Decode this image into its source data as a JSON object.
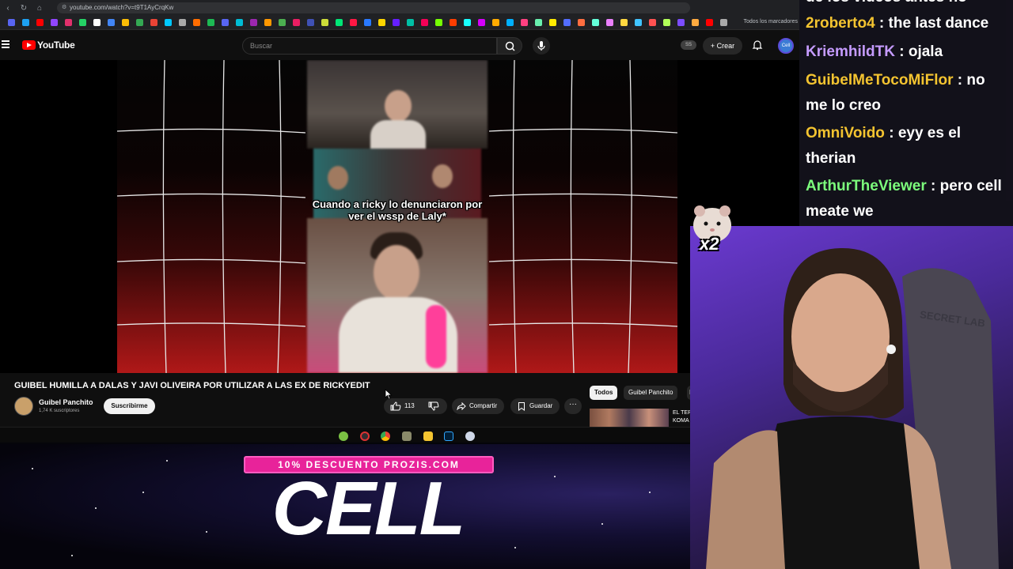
{
  "browser": {
    "url": "youtube.com/watch?v=t9T1AyCrqKw",
    "bookmarks_all_label": "Todos los marcadores"
  },
  "youtube": {
    "logo_text": "YouTube",
    "search_placeholder": "Buscar",
    "ss_badge": "SS",
    "create_label": "Crear",
    "avatar_label": "Cell"
  },
  "video": {
    "caption": "Cuando a ricky lo denunciaron por ver el wssp de Laly*",
    "title": "GUIBEL HUMILLA A DALAS Y JAVI OLIVEIRA POR UTILIZAR A LAS EX DE RICKYEDIT",
    "channel_name": "Guibel Panchito",
    "channel_subs": "1,74 K suscriptores",
    "subscribe_label": "Suscribirme",
    "like_count": "113",
    "share_label": "Compartir",
    "save_label": "Guardar",
    "more_label": "···"
  },
  "recommendations": {
    "chips": [
      "Todos",
      "Guibel Panchito",
      "I"
    ],
    "first_title": "EL TER KOMA"
  },
  "chat": {
    "top_fragment": "de los videos antes no",
    "messages": [
      {
        "user": "2roberto4",
        "text": "the last dance"
      },
      {
        "user": "KriemhildTK",
        "text": "ojala"
      },
      {
        "user": "GuibelMeTocoMiFlor",
        "text": "no me lo creo"
      },
      {
        "user": "OmniVoido",
        "text": "eyy es el therian"
      },
      {
        "user": "ArthurTheViewer",
        "text": "pero cell meate we"
      }
    ]
  },
  "emote": {
    "count": "x2"
  },
  "overlay": {
    "promo_text": "10% DESCUENTO PROZIS.COM",
    "brand_text": "CELL"
  },
  "colors": {
    "youtube_red": "#ff0000",
    "promo_pink": "#e8239a",
    "chat_user_gold": "#f4c430",
    "chat_user_purple": "#c59bff",
    "chat_user_green": "#7cfc7c"
  }
}
